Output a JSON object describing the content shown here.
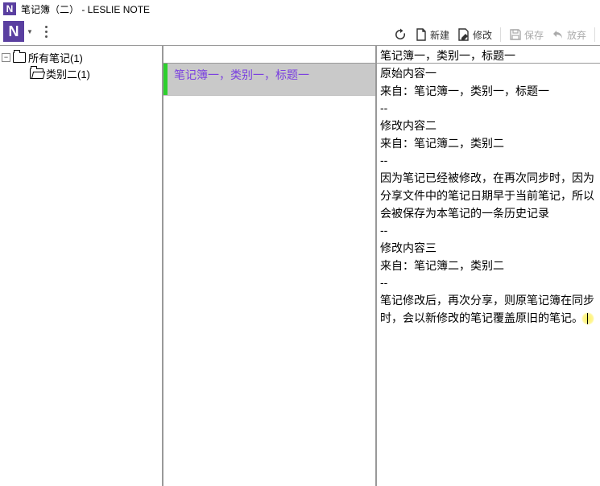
{
  "window": {
    "title": "笔记簿（二）   - LESLIE NOTE"
  },
  "toolbar": {
    "refresh": "",
    "new_label": "新建",
    "edit_label": "修改",
    "save_label": "保存",
    "discard_label": "放弃"
  },
  "sidebar": {
    "root_label": "所有笔记(1)",
    "child_label": "类别二(1)"
  },
  "notelist": {
    "items": [
      {
        "title": "笔记簿一，类别一，标题一"
      }
    ]
  },
  "content": {
    "title": "笔记簿一，类别一，标题一",
    "lines": [
      "原始内容一",
      "来自：笔记簿一，类别一，标题一",
      "--",
      "修改内容二",
      "来自：笔记簿二，类别二",
      "--",
      "因为笔记已经被修改，在再次同步时，因为分享文件中的笔记日期早于当前笔记，所以会被保存为本笔记的一条历史记录",
      "--",
      "修改内容三",
      "来自：笔记簿二，类别二",
      "--",
      "笔记修改后，再次分享，则原笔记簿在同步时，会以新修改的笔记覆盖原旧的笔记。"
    ]
  }
}
